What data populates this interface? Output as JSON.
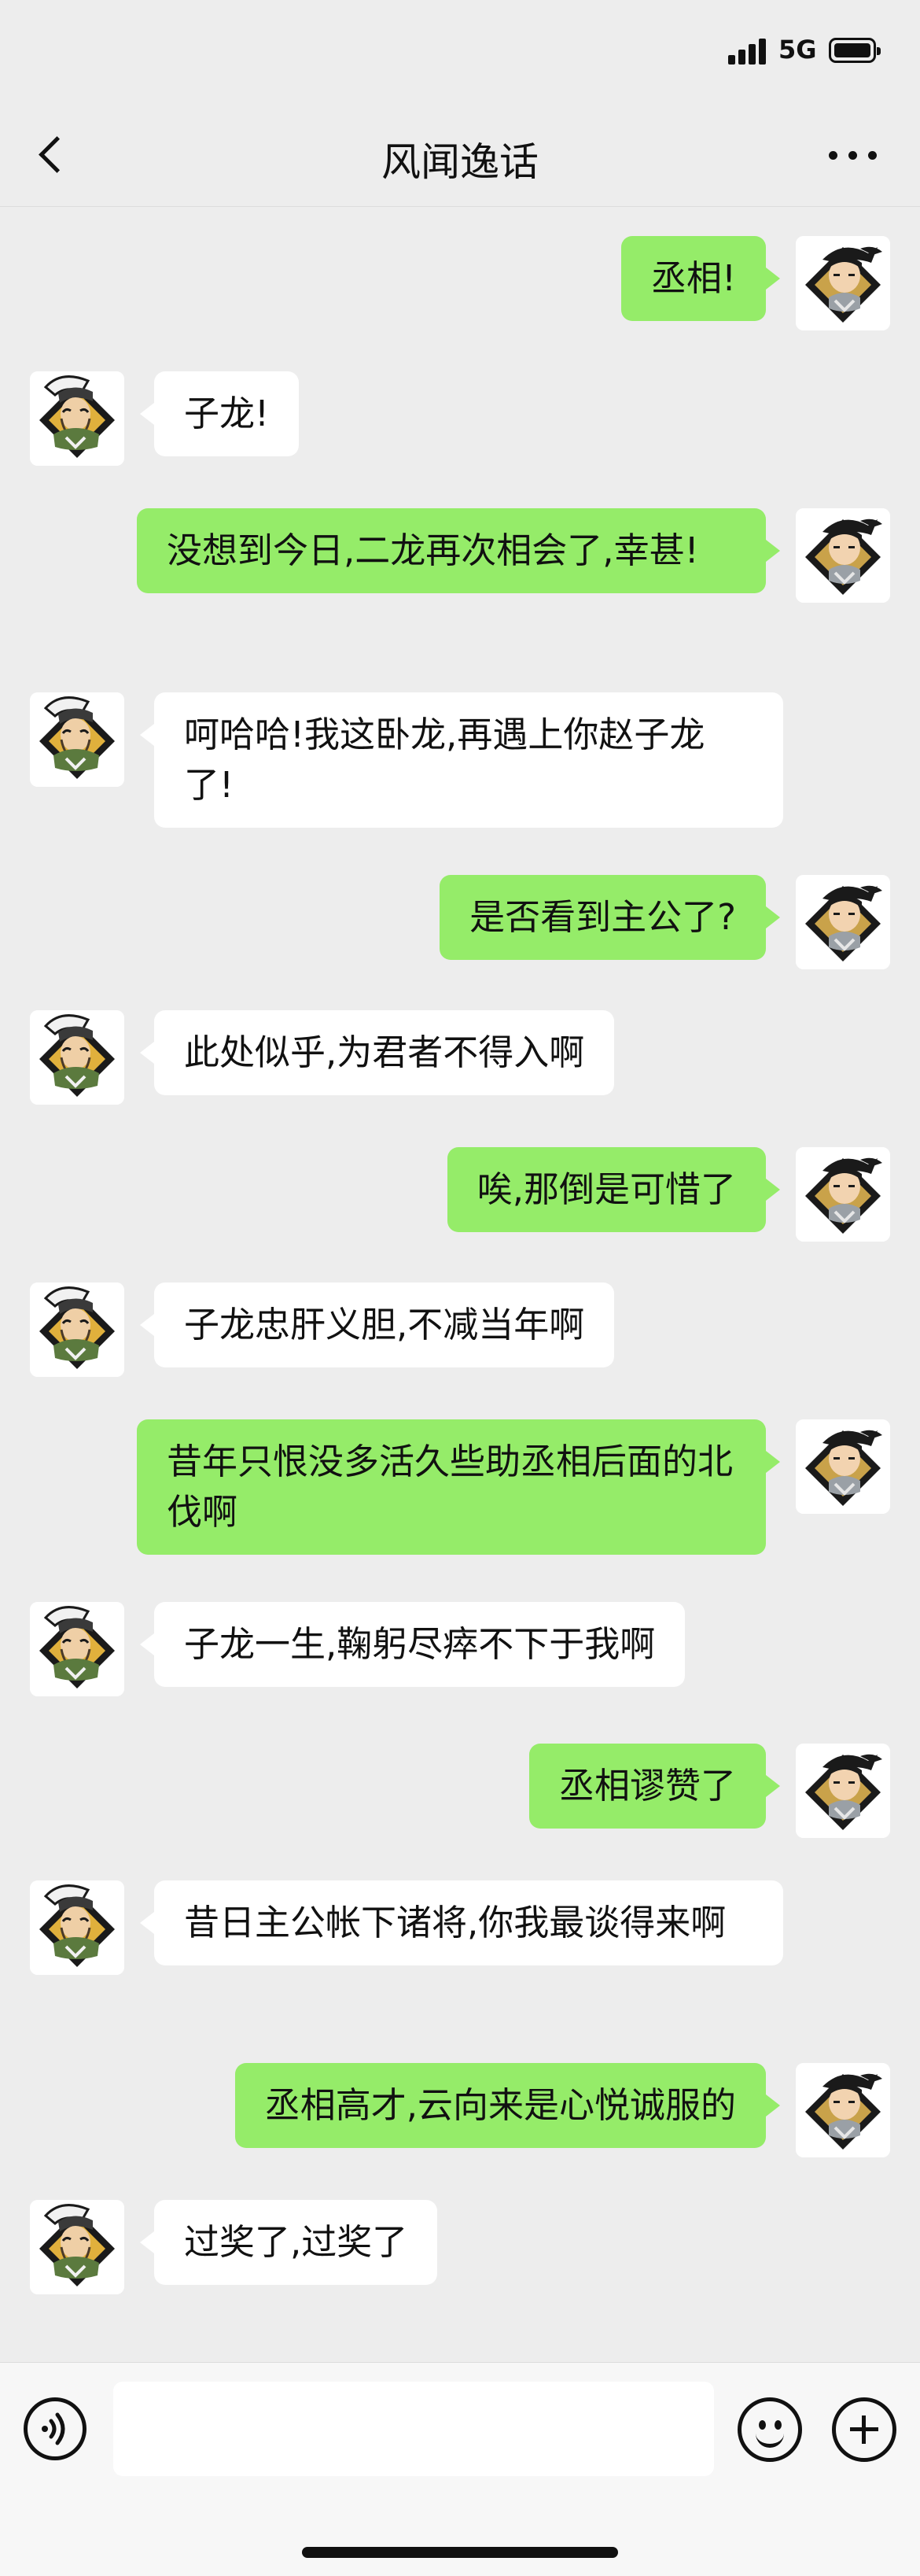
{
  "status_bar": {
    "network": "5G",
    "signal_bars": 4,
    "battery_percent": 100
  },
  "nav": {
    "title": "风闻逸话"
  },
  "messages": [
    {
      "side": "right",
      "text": "丞相!"
    },
    {
      "side": "left",
      "text": "子龙!"
    },
    {
      "side": "right",
      "text": "没想到今日,二龙再次相会了,幸甚!"
    },
    {
      "side": "left",
      "text": "呵哈哈!我这卧龙,再遇上你赵子龙了!"
    },
    {
      "side": "right",
      "text": "是否看到主公了?"
    },
    {
      "side": "left",
      "text": "此处似乎,为君者不得入啊"
    },
    {
      "side": "right",
      "text": "唉,那倒是可惜了"
    },
    {
      "side": "left",
      "text": "子龙忠肝义胆,不减当年啊"
    },
    {
      "side": "right",
      "text": "昔年只恨没多活久些助丞相后面的北伐啊"
    },
    {
      "side": "left",
      "text": "子龙一生,鞠躬尽瘁不下于我啊"
    },
    {
      "side": "right",
      "text": "丞相谬赞了"
    },
    {
      "side": "left",
      "text": "昔日主公帐下诸将,你我最谈得来啊"
    },
    {
      "side": "right",
      "text": "丞相高才,云向来是心悦诚服的"
    },
    {
      "side": "left",
      "text": "过奖了,过奖了"
    }
  ],
  "input": {
    "value": "",
    "placeholder": ""
  },
  "colors": {
    "background": "#ededed",
    "outgoing_bubble": "#95ec69",
    "incoming_bubble": "#ffffff"
  },
  "icons": {
    "back": "chevron-left-icon",
    "more": "more-dots-icon",
    "voice": "voice-icon",
    "emoji": "emoji-icon",
    "plus": "plus-circle-icon"
  }
}
